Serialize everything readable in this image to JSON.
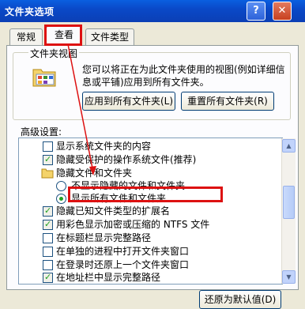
{
  "window": {
    "title": "文件夹选项",
    "help_label": "?",
    "close_label": "✕"
  },
  "tabs": [
    {
      "label": "常规"
    },
    {
      "label": "查看",
      "active": true
    },
    {
      "label": "文件类型"
    }
  ],
  "folder_views": {
    "title": "文件夹视图",
    "description": "您可以将正在为此文件夹使用的视图(例如详细信息或平铺)应用到所有文件夹。",
    "apply_button": "应用到所有文件夹(L)",
    "reset_button": "重置所有文件夹(R)"
  },
  "advanced": {
    "label": "高级设置:",
    "items": [
      {
        "text": "显示系统文件夹的内容",
        "kind": "checkbox",
        "checked": false
      },
      {
        "text": "隐藏受保护的操作系统文件(推荐)",
        "kind": "checkbox",
        "checked": true
      },
      {
        "text": "隐藏文件和文件夹",
        "kind": "folder"
      },
      {
        "text": "不显示隐藏的文件和文件夹",
        "kind": "radio",
        "checked": false
      },
      {
        "text": "显示所有文件和文件夹",
        "kind": "radio",
        "checked": true
      },
      {
        "text": "隐藏已知文件类型的扩展名",
        "kind": "checkbox",
        "checked": true
      },
      {
        "text": "用彩色显示加密或压缩的 NTFS 文件",
        "kind": "checkbox",
        "checked": true
      },
      {
        "text": "在标题栏显示完整路径",
        "kind": "checkbox",
        "checked": false
      },
      {
        "text": "在单独的进程中打开文件夹窗口",
        "kind": "checkbox",
        "checked": false
      },
      {
        "text": "在登录时还原上一个文件夹窗口",
        "kind": "checkbox",
        "checked": false
      },
      {
        "text": "在地址栏中显示完整路径",
        "kind": "checkbox",
        "checked": true
      }
    ]
  },
  "restore_button": "还原为默认值(D)",
  "colors": {
    "titlebar": "#0a49c8",
    "highlight": "#dd1111",
    "dialog_bg": "#ece9d8"
  }
}
